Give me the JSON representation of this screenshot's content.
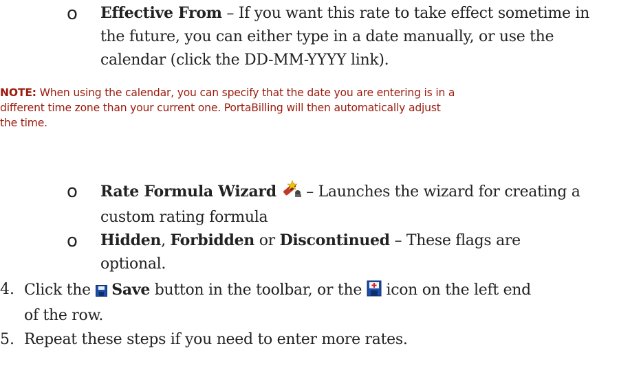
{
  "items": {
    "effective": {
      "bullet": "o",
      "title": "Effective From",
      "body_lines": [
        "– If you want this rate to take effect sometime in",
        "the future, you can either type in a date manually, or use the",
        "calendar (click the DD-MM-YYYY link)."
      ]
    },
    "note": {
      "label": "NOTE:",
      "lines": [
        "When using the calendar, you can specify that the date you are entering is in a",
        "different time zone than your current one. PortaBilling will then automatically adjust",
        "the time."
      ]
    },
    "wizard": {
      "bullet": "o",
      "title": "Rate Formula Wizard",
      "body_lines": [
        "– Launches the wizard for creating a",
        "custom rating formula"
      ]
    },
    "flags": {
      "bullet": "o",
      "title_1": "Hidden",
      "sep_1": ",",
      "title_2": "Forbidden",
      "sep_2": "or",
      "title_3": "Discontinued",
      "body_lines": [
        "– These flags are",
        "optional."
      ]
    },
    "step4": {
      "number": "4.",
      "prefix": "Click the",
      "save_label": "Save",
      "middle": "button in the toolbar, or the",
      "suffix": "icon on the left end",
      "line2": "of the row."
    },
    "step5": {
      "number": "5.",
      "text": "Repeat these steps if you need to enter more rates."
    }
  },
  "icons": {
    "wizard": "rate-formula-wizard-icon",
    "save": "save-icon",
    "save_row": "save-row-icon"
  },
  "colors": {
    "note": "#9b1b0d",
    "text": "#222222",
    "save_icon": "#1c4ea8"
  }
}
